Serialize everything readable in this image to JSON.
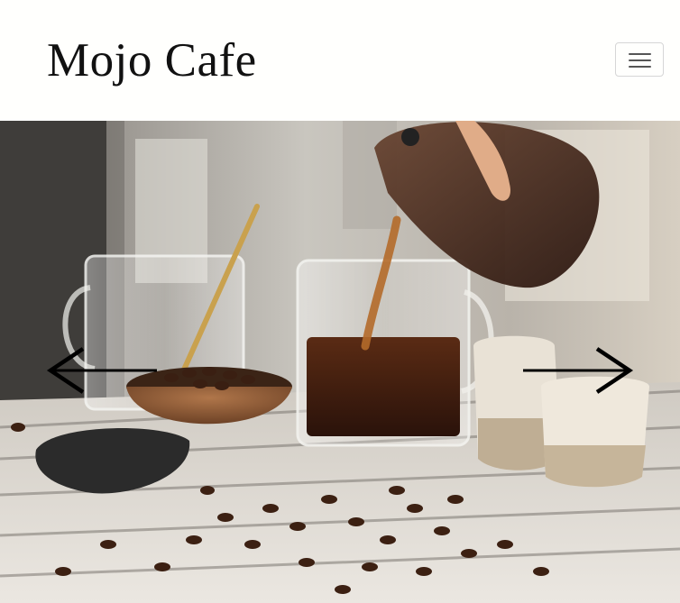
{
  "header": {
    "brand": "Mojo Cafe",
    "menu_icon": "hamburger-menu-icon"
  },
  "hero": {
    "image": "coffee-pour-scene",
    "prev_icon": "arrow-left-icon",
    "next_icon": "arrow-right-icon"
  },
  "colors": {
    "header_bg": "#fffffd",
    "brand_text": "#111111",
    "arrow": "#000000",
    "coffee": "#3a1d10"
  }
}
